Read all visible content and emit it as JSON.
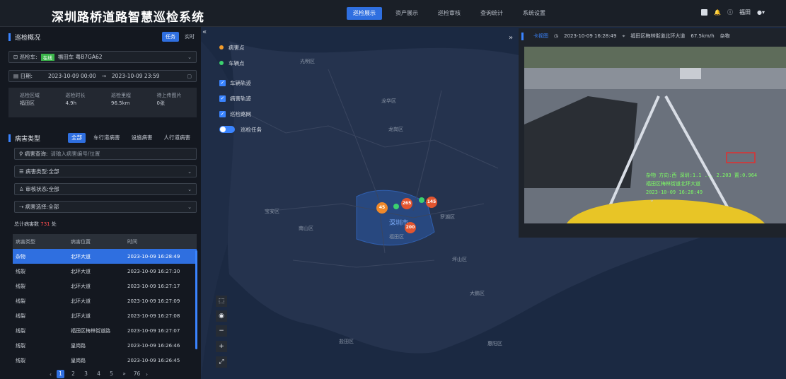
{
  "header": {
    "title": "深圳路桥道路智慧巡检系统",
    "nav": [
      "巡检展示",
      "资产展示",
      "巡检审核",
      "查询统计",
      "系统设置"
    ],
    "active_nav": "巡检展示",
    "user": "福田"
  },
  "overview": {
    "title": "巡检概况",
    "mode_buttons": [
      "任务",
      "实时"
    ],
    "vehicle_label": "巡检车:",
    "vehicle_status": "在线",
    "vehicle_value": "福田车 粤B7GA62",
    "date_label": "日期:",
    "date_start": "2023-10-09 00:00",
    "date_sep": "→",
    "date_end": "2023-10-09 23:59",
    "stats": [
      {
        "label": "巡检区域",
        "value": "福田区"
      },
      {
        "label": "巡检时长",
        "value": "4.9h"
      },
      {
        "label": "巡检里程",
        "value": "96.5km"
      },
      {
        "label": "待上传图片",
        "value": "0张"
      }
    ]
  },
  "disease": {
    "title": "病害类型",
    "tabs": [
      "全部",
      "车行道病害",
      "设施病害",
      "人行道病害"
    ],
    "filters": [
      {
        "label": "病害查询:",
        "value": "请输入病害编号/位置"
      },
      {
        "label": "病害类型:",
        "value": "全部"
      },
      {
        "label": "审核状态:",
        "value": "全部"
      },
      {
        "label": "病害选择:",
        "value": "全部"
      }
    ],
    "total_label": "总计病害数",
    "total_value": "731",
    "total_unit": "处"
  },
  "table": {
    "headers": [
      "病害类型",
      "病害位置",
      "时间"
    ],
    "rows": [
      [
        "杂物",
        "北环大道",
        "2023-10-09 16:28:49"
      ],
      [
        "线裂",
        "北环大道",
        "2023-10-09 16:27:30"
      ],
      [
        "线裂",
        "北环大道",
        "2023-10-09 16:27:17"
      ],
      [
        "线裂",
        "北环大道",
        "2023-10-09 16:27:09"
      ],
      [
        "线裂",
        "北环大道",
        "2023-10-09 16:27:08"
      ],
      [
        "线裂",
        "福田区梅林街道路",
        "2023-10-09 16:27:07"
      ],
      [
        "线裂",
        "皇岗路",
        "2023-10-09 16:26:46"
      ],
      [
        "线裂",
        "皇岗路",
        "2023-10-09 16:26:45"
      ]
    ]
  },
  "pagination": {
    "pages": [
      "1",
      "2",
      "3",
      "4",
      "5",
      "»",
      "76"
    ],
    "current": "1"
  },
  "map_legend": {
    "points": [
      {
        "label": "病害点",
        "color": "#f39c2b"
      },
      {
        "label": "车辆点",
        "color": "#3bd16f"
      }
    ],
    "checks": [
      "车辆轨迹",
      "病害轨迹",
      "巡检路网"
    ],
    "toggle_label": "巡检任务"
  },
  "map": {
    "clusters": [
      "45",
      "265",
      "145",
      "200"
    ],
    "places": [
      "深圳市",
      "福田区",
      "宝安区",
      "南山区",
      "龙岗区",
      "罗湖区",
      "龙华区",
      "坪山区",
      "大鹏区",
      "惠阳区",
      "盐田区",
      "光明区"
    ]
  },
  "video": {
    "title": "卡视图",
    "time": "2023-10-09 16:28:49",
    "location": "福田区梅林街道北环大道",
    "speed": "67.5km/h",
    "type": "杂物",
    "ocr_lines": [
      "杂物 方向:西 深圳:1.1 ... 2.203 置:0.964",
      "福田区梅林街道北环大道",
      "2023-10-09 16:28:49"
    ]
  }
}
